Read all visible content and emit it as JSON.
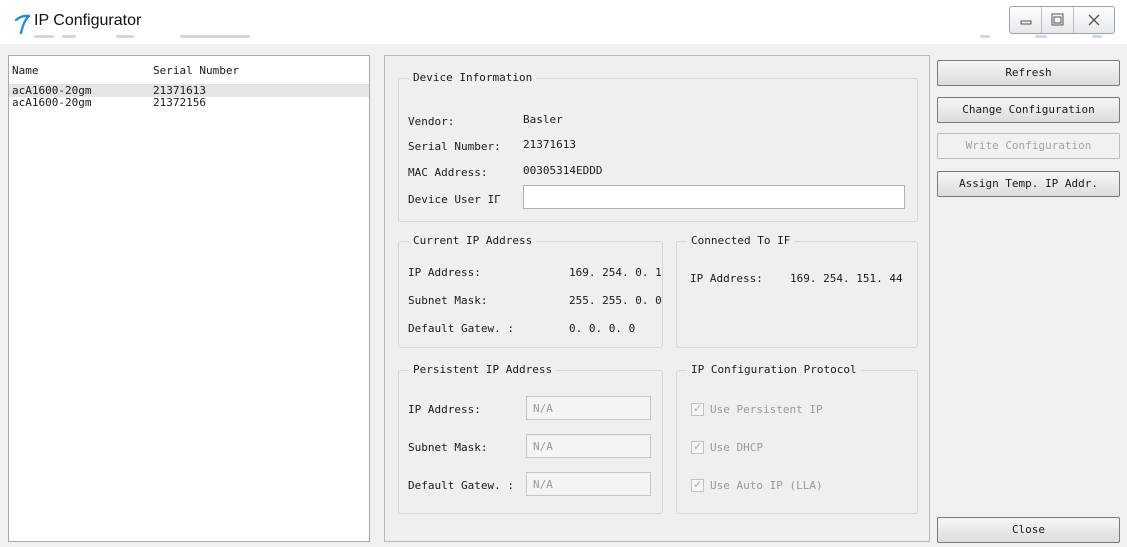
{
  "window": {
    "title": "IP Configurator"
  },
  "device_list": {
    "columns": [
      "Name",
      "Serial Number"
    ],
    "rows": [
      {
        "name": "acA1600-20gm",
        "serial": "21371613",
        "selected": true
      },
      {
        "name": "acA1600-20gm",
        "serial": "21372156",
        "selected": false
      }
    ]
  },
  "device_info": {
    "legend": "Device Information",
    "vendor_label": "Vendor:",
    "vendor_value": "Basler",
    "serial_label": "Serial Number:",
    "serial_value": "21371613",
    "mac_label": "MAC Address:",
    "mac_value": "00305314EDDD",
    "user_id_label": "Device User IΓ",
    "user_id_value": ""
  },
  "current_ip": {
    "legend": "Current IP Address",
    "ip_label": "IP Address:",
    "ip_value": "169. 254. 0. 1",
    "mask_label": "Subnet Mask:",
    "mask_value": "255. 255. 0. 0",
    "gw_label": "Default Gatew. :",
    "gw_value": "0. 0. 0. 0"
  },
  "connected_if": {
    "legend": "Connected To IF",
    "ip_label": "IP Address:",
    "ip_value": "169. 254. 151. 44"
  },
  "persistent_ip": {
    "legend": "Persistent IP Address",
    "ip_label": "IP Address:",
    "ip_value": "N/A",
    "mask_label": "Subnet Mask:",
    "mask_value": "N/A",
    "gw_label": "Default Gatew. :",
    "gw_value": "N/A"
  },
  "ip_protocol": {
    "legend": "IP Configuration Protocol",
    "persistent_label": "Use Persistent IP",
    "dhcp_label": "Use DHCP",
    "auto_label": "Use Auto IP (LLA)"
  },
  "buttons": {
    "refresh": "Refresh",
    "change": "Change Configuration",
    "write": "Write Configuration",
    "assign": "Assign Temp. IP Addr.",
    "close": "Close"
  }
}
